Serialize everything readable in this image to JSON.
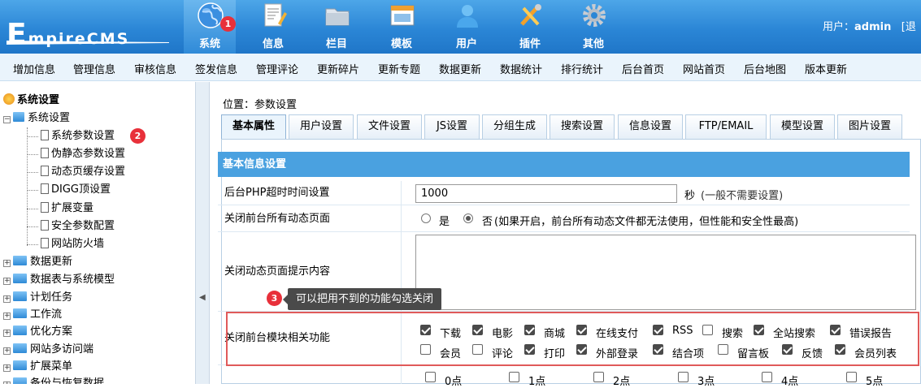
{
  "header": {
    "logo_text_big": "E",
    "logo_text_rest": "mpireCMS",
    "nav": [
      {
        "label": "系统",
        "icon": "globe-icon",
        "active": true,
        "badge": "1"
      },
      {
        "label": "信息",
        "icon": "document-edit-icon"
      },
      {
        "label": "栏目",
        "icon": "folder-icon"
      },
      {
        "label": "模板",
        "icon": "window-template-icon"
      },
      {
        "label": "用户",
        "icon": "user-icon"
      },
      {
        "label": "插件",
        "icon": "tools-icon"
      },
      {
        "label": "其他",
        "icon": "gear-icon"
      }
    ],
    "user_prefix": "用户：",
    "user_name": "admin",
    "user_suffix": "[退"
  },
  "menubar": [
    "增加信息",
    "管理信息",
    "审核信息",
    "签发信息",
    "管理评论",
    "更新碎片",
    "更新专题",
    "数据更新",
    "数据统计",
    "排行统计",
    "后台首页",
    "网站首页",
    "后台地图",
    "版本更新"
  ],
  "sidebar": {
    "root": "系统设置",
    "group": "系统设置",
    "children": [
      "系统参数设置",
      "伪静态参数设置",
      "动态页缓存设置",
      "DIGG顶设置",
      "扩展变量",
      "安全参数配置",
      "网站防火墙"
    ],
    "child_badge": "2",
    "folders": [
      "数据更新",
      "数据表与系统模型",
      "计划任务",
      "工作流",
      "优化方案",
      "网站多访问端",
      "扩展菜单",
      "备份与恢复数据"
    ]
  },
  "splitter_arrow": "◀",
  "main": {
    "breadcrumb": "位置：参数设置",
    "tabs": [
      "基本属性",
      "用户设置",
      "文件设置",
      "JS设置",
      "分组生成",
      "搜索设置",
      "信息设置",
      "FTP/EMAIL",
      "模型设置",
      "图片设置"
    ],
    "section_title": "基本信息设置",
    "php_timeout": {
      "label": "后台PHP超时时间设置",
      "value": "1000",
      "unit": "秒",
      "hint": "(一般不需要设置)"
    },
    "close_dynamic": {
      "label": "关闭前台所有动态页面",
      "yes": "是",
      "no": "否",
      "hint": "(如果开启，前台所有动态文件都无法使用，但性能和安全性最高)"
    },
    "close_msg": {
      "label": "关闭动态页面提示内容",
      "value": ""
    },
    "tooltip": {
      "badge": "3",
      "text": "可以把用不到的功能勾选关闭"
    },
    "modules": {
      "label": "关闭前台模块相关功能",
      "row1": [
        {
          "label": "下载",
          "checked": true
        },
        {
          "label": "电影",
          "checked": true
        },
        {
          "label": "商城",
          "checked": true
        },
        {
          "label": "在线支付",
          "checked": true
        },
        {
          "label": "RSS",
          "checked": true
        },
        {
          "label": "搜索",
          "checked": false
        },
        {
          "label": "全站搜索",
          "checked": true
        },
        {
          "label": "错误报告",
          "checked": true
        }
      ],
      "row2": [
        {
          "label": "会员",
          "checked": false
        },
        {
          "label": "评论",
          "checked": false
        },
        {
          "label": "打印",
          "checked": true
        },
        {
          "label": "外部登录",
          "checked": true
        },
        {
          "label": "结合项",
          "checked": true
        },
        {
          "label": "留言板",
          "checked": false
        },
        {
          "label": "反馈",
          "checked": true
        },
        {
          "label": "会员列表",
          "checked": true
        }
      ]
    },
    "hours": [
      "0点",
      "1点",
      "2点",
      "3点",
      "4点",
      "5点"
    ]
  },
  "colors": {
    "accent": "#2b86d6",
    "header_bar": "#4aa1e0",
    "badge": "#e8303a",
    "highlight_box": "#e05a5a"
  }
}
